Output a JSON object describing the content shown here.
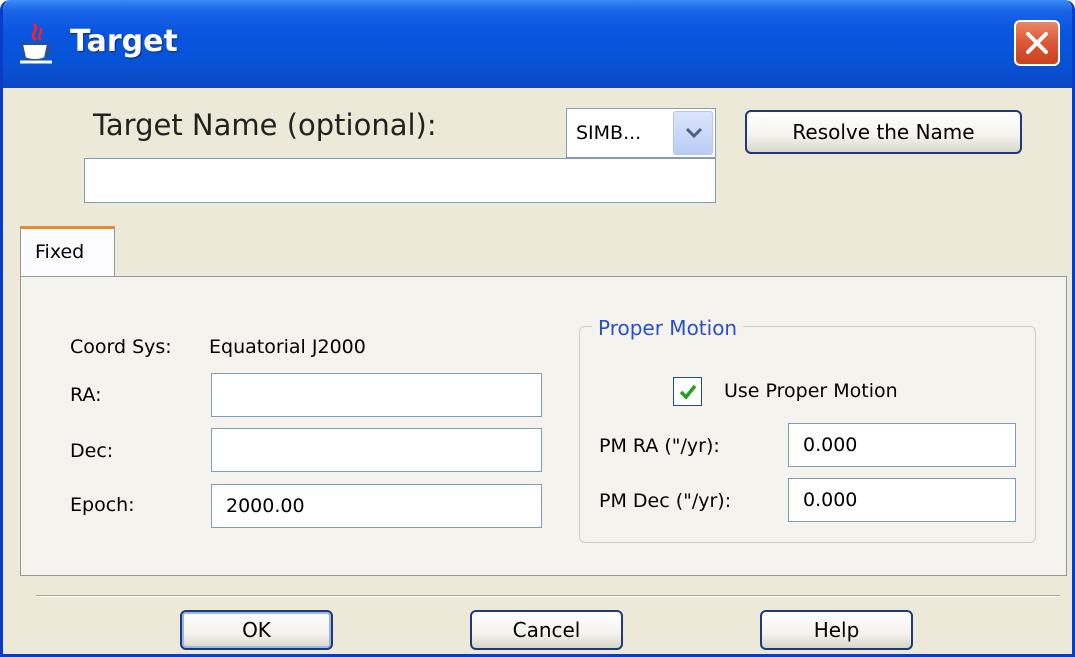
{
  "window": {
    "title": "Target",
    "icon": "java-cup-icon",
    "close_icon": "close-icon"
  },
  "name_section": {
    "label": "Target Name (optional):",
    "resolver_selected": "SIMB...",
    "resolve_button": "Resolve the Name",
    "name_value": ""
  },
  "tabs": [
    {
      "label": "Fixed",
      "selected": true
    }
  ],
  "fixed": {
    "coord_sys_label": "Coord Sys:",
    "coord_sys_value": "Equatorial J2000",
    "ra_label": "RA:",
    "ra_value": "",
    "dec_label": "Dec:",
    "dec_value": "",
    "epoch_label": "Epoch:",
    "epoch_value": "2000.00"
  },
  "proper_motion": {
    "title": "Proper Motion",
    "use_label": "Use Proper Motion",
    "use_checked": true,
    "pm_ra_label": "PM RA (\"/yr):",
    "pm_ra_value": "0.000",
    "pm_dec_label": "PM Dec (\"/yr):",
    "pm_dec_value": "0.000"
  },
  "buttons": {
    "ok": "OK",
    "cancel": "Cancel",
    "help": "Help"
  },
  "colors": {
    "titlebar": "#0653d6",
    "window_bg": "#ece9d8",
    "panel_bg": "#f4f3ee",
    "group_title": "#2a4fc4",
    "tab_accent": "#e68b2c",
    "check": "#21a121"
  }
}
